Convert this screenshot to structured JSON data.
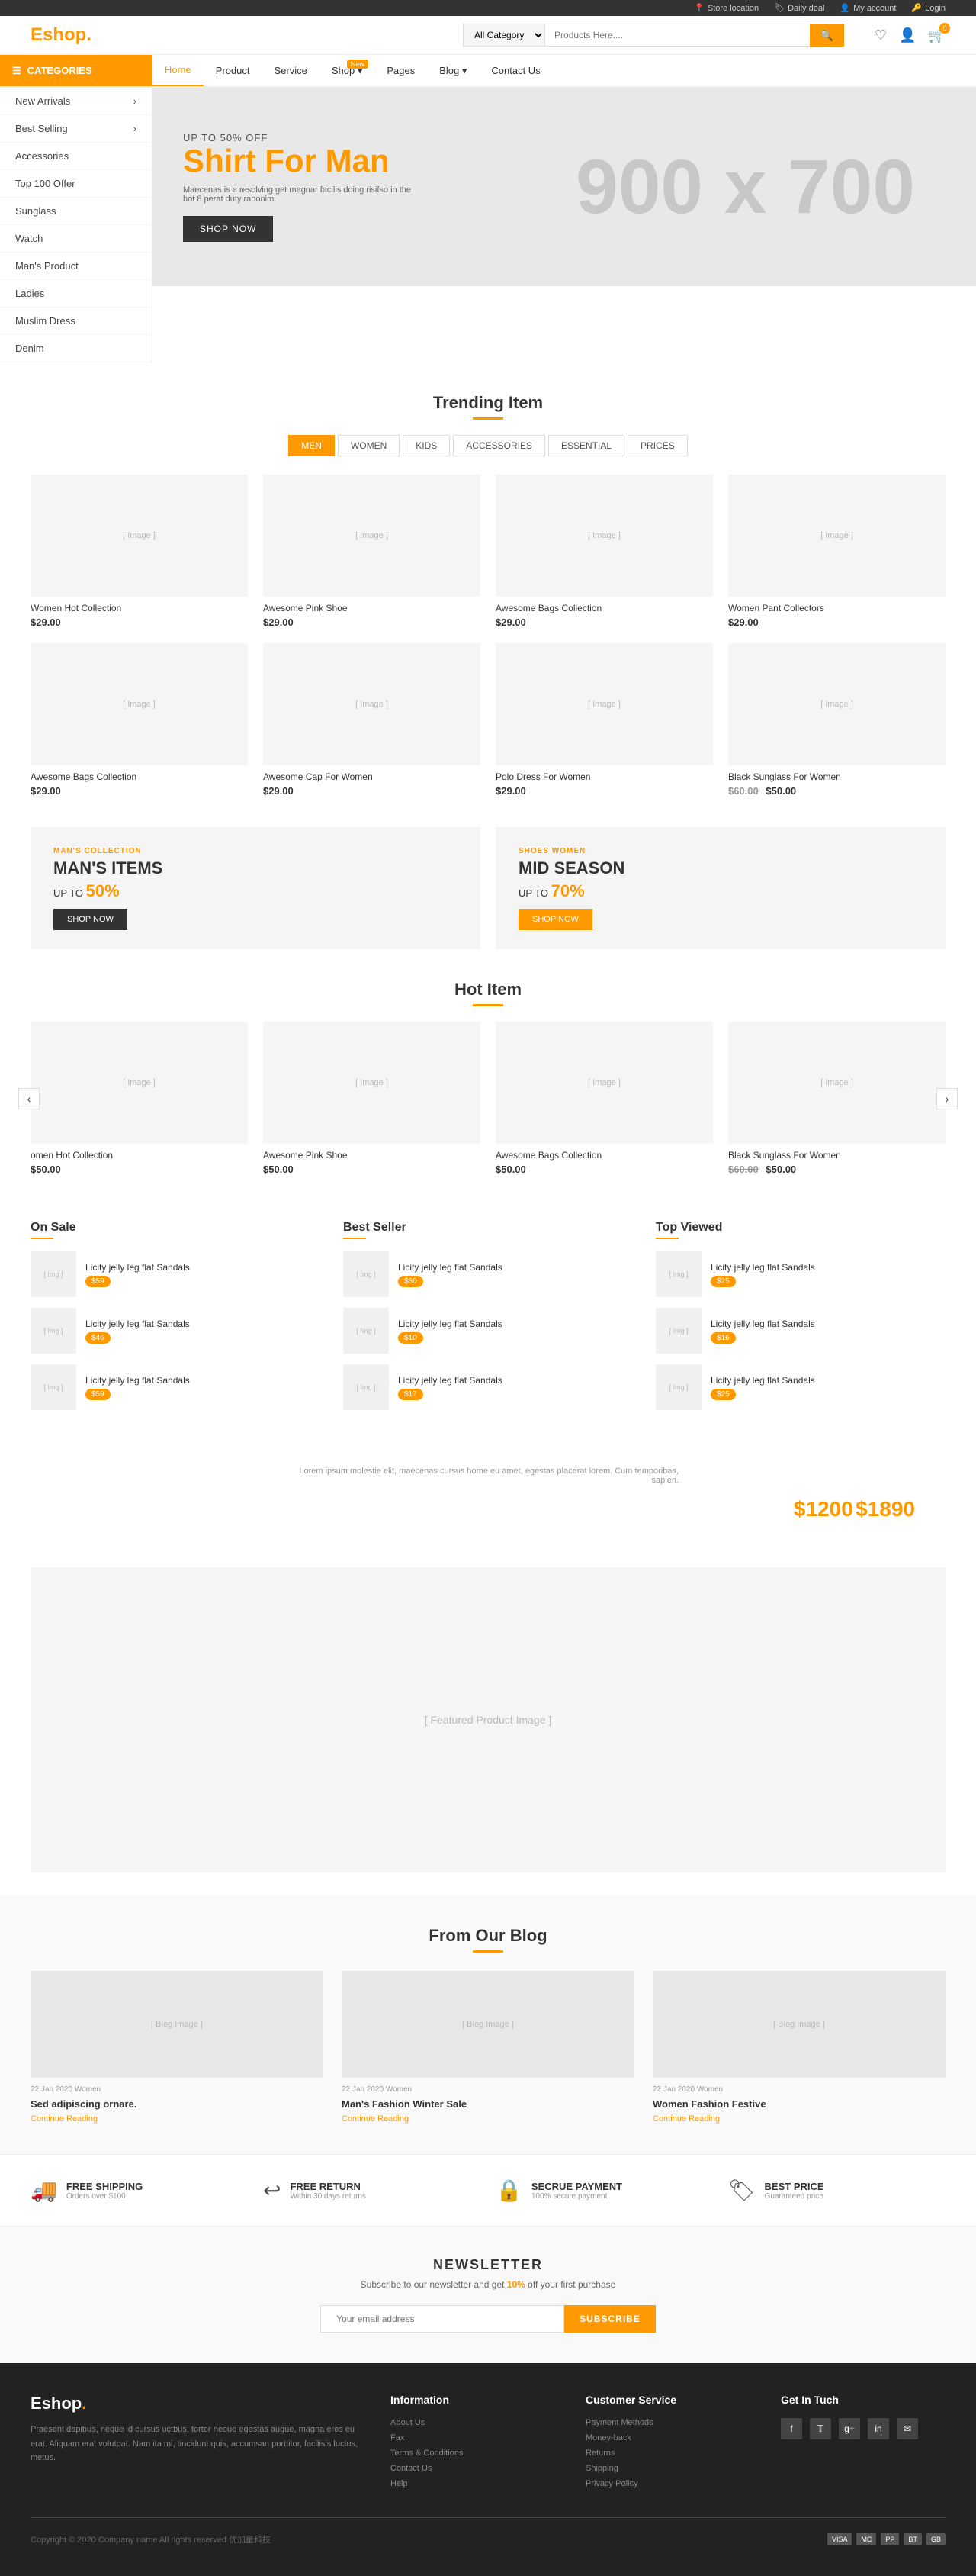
{
  "topbar": {
    "store_location": "Store location",
    "daily_deal": "Daily deal",
    "my_account": "My account",
    "login": "Login"
  },
  "header": {
    "logo": "Eshop",
    "logo_dot": ".",
    "search_placeholder": "Products Here....",
    "search_category": "All Category",
    "icons": {
      "wishlist": "♡",
      "account": "👤",
      "cart": "🛒",
      "cart_count": "0"
    }
  },
  "nav": {
    "categories_label": "CATEGORIES",
    "links": [
      {
        "label": "Home",
        "active": true
      },
      {
        "label": "Product"
      },
      {
        "label": "Service"
      },
      {
        "label": "Shop",
        "badge": "New"
      },
      {
        "label": "Pages"
      },
      {
        "label": "Blog"
      },
      {
        "label": "Contact Us"
      }
    ]
  },
  "sidebar": {
    "items": [
      {
        "label": "New Arrivals",
        "has_arrow": true
      },
      {
        "label": "Best Selling",
        "has_arrow": true
      },
      {
        "label": "Accessories"
      },
      {
        "label": "Top 100 Offer"
      },
      {
        "label": "Sunglass"
      },
      {
        "label": "Watch"
      },
      {
        "label": "Man's Product"
      },
      {
        "label": "Ladies"
      },
      {
        "label": "Muslim Dress"
      },
      {
        "label": "Denim"
      }
    ]
  },
  "hero": {
    "subtitle": "UP TO 50% OFF",
    "title": "Shirt For Man",
    "description": "Maecenas is a resolving get magnar facilis doing risifso in the hot 8 perat duty rabonim.",
    "size_text": "900 x 700",
    "cta_label": "SHOP NOW"
  },
  "trending": {
    "title": "Trending Item",
    "tabs": [
      "MEN",
      "WOMEN",
      "KIDS",
      "ACCESSORIES",
      "ESSENTIAL",
      "PRICES"
    ],
    "active_tab": 0,
    "products": [
      {
        "name": "Women Hot Collection",
        "price": "$29.00"
      },
      {
        "name": "Awesome Pink Shoe",
        "price": "$29.00"
      },
      {
        "name": "Awesome Bags Collection",
        "price": "$29.00"
      },
      {
        "name": "Women Pant Collectors",
        "price": "$29.00"
      },
      {
        "name": "Awesome Bags Collection",
        "price": "$29.00"
      },
      {
        "name": "Awesome Cap For Women",
        "price": "$29.00"
      },
      {
        "name": "Polo Dress For Women",
        "price": "$29.00"
      },
      {
        "name": "Black Sunglass For Women",
        "old_price": "$60.00",
        "price": "$50.00"
      }
    ]
  },
  "promo": [
    {
      "category": "MAN'S COLLECTION",
      "title": "MAN'S ITEMS",
      "discount_label": "UP TO",
      "discount": "50%",
      "cta": "SHOP NOW",
      "bg": "#f5f5f5"
    },
    {
      "category": "SHOES WOMEN",
      "title": "MID SEASON",
      "discount_label": "UP TO",
      "discount": "70%",
      "cta": "SHOP NOW",
      "bg": "#f5f5f5"
    }
  ],
  "hot": {
    "title": "Hot Item",
    "products": [
      {
        "name": "omen Hot Collection",
        "price": "$50.00"
      },
      {
        "name": "Awesome Pink Shoe",
        "price": "$50.00"
      },
      {
        "name": "Awesome Bags Collection",
        "price": "$50.00"
      },
      {
        "name": "Black Sunglass For Women",
        "old_price": "$60.00",
        "price": "$50.00"
      }
    ]
  },
  "on_sale": {
    "title": "On Sale",
    "items": [
      {
        "name": "Licity jelly leg flat Sandals",
        "price": "$59"
      },
      {
        "name": "Licity jelly leg flat Sandals",
        "price": "$46"
      },
      {
        "name": "Licity jelly leg flat Sandals",
        "price": "$59"
      }
    ]
  },
  "best_seller": {
    "title": "Best Seller",
    "items": [
      {
        "name": "Licity jelly leg flat Sandals",
        "price": "$60"
      },
      {
        "name": "Licity jelly leg flat Sandals",
        "price": "$10"
      },
      {
        "name": "Licity jelly leg flat Sandals",
        "price": "$17"
      }
    ]
  },
  "top_viewed": {
    "title": "Top Viewed",
    "items": [
      {
        "name": "Licity jelly leg flat Sandals",
        "price": "$25"
      },
      {
        "name": "Licity jelly leg flat Sandals",
        "price": "$16"
      },
      {
        "name": "Licity jelly leg flat Sandals",
        "price": "$25"
      }
    ]
  },
  "featured": {
    "description": "Lorem ipsum molestie elit, maecenas cursus home eu amet, egestas placerat lorem. Cum temporibas, sapien.",
    "price": "$1200",
    "old_price": "$1890"
  },
  "blog": {
    "title": "From Our Blog",
    "posts": [
      {
        "meta": "22 Jan 2020 Women",
        "title": "Sed adipiscing ornare.",
        "cta": "Continue Reading"
      },
      {
        "meta": "22 Jan 2020 Women",
        "title": "Man's Fashion Winter Sale",
        "cta": "Continue Reading"
      },
      {
        "meta": "22 Jan 2020 Women",
        "title": "Women Fashion Festive",
        "cta": "Continue Reading"
      }
    ]
  },
  "features": [
    {
      "icon": "🚚",
      "title": "FREE SHIPPING",
      "desc": "Orders over $100"
    },
    {
      "icon": "↩",
      "title": "FREE RETURN",
      "desc": "Within 30 days returns"
    },
    {
      "icon": "🔒",
      "title": "SECRUE PAYMENT",
      "desc": "100% secure payment"
    },
    {
      "icon": "🏷",
      "title": "BEST PRICE",
      "desc": "Guaranteed price"
    }
  ],
  "newsletter": {
    "title": "NEWSLETTER",
    "subtitle_before": "Subscribe to our newsletter and get ",
    "highlight": "10%",
    "subtitle_after": " off your first purchase",
    "placeholder": "Your email address",
    "cta": "SUBSCRIBE"
  },
  "footer": {
    "logo": "Eshop",
    "description": "Praesent dapibus, neque id cursus uctbus, tortor neque egestas augue, magna eros eu erat. Aliquam erat volutpat. Nam ita mi, tincidunt quis, accumsan porttitor, facilisis luctus, metus.",
    "columns": [
      {
        "heading": "Information",
        "links": [
          "About Us",
          "Fax",
          "Terms & Conditions",
          "Contact Us",
          "Help"
        ]
      },
      {
        "heading": "Customer Service",
        "links": [
          "Payment Methods",
          "Money-back",
          "Returns",
          "Shipping",
          "Privacy Policy"
        ]
      },
      {
        "heading": "Get In Tuch",
        "social": [
          "f",
          "𝕋",
          "g+",
          "in",
          "✉"
        ]
      }
    ],
    "copyright": "Copyright © 2020 Company name All rights reserved 优加星科技",
    "payment_icons": [
      "VISA",
      "MC",
      "PP",
      "BT",
      "GB"
    ]
  }
}
